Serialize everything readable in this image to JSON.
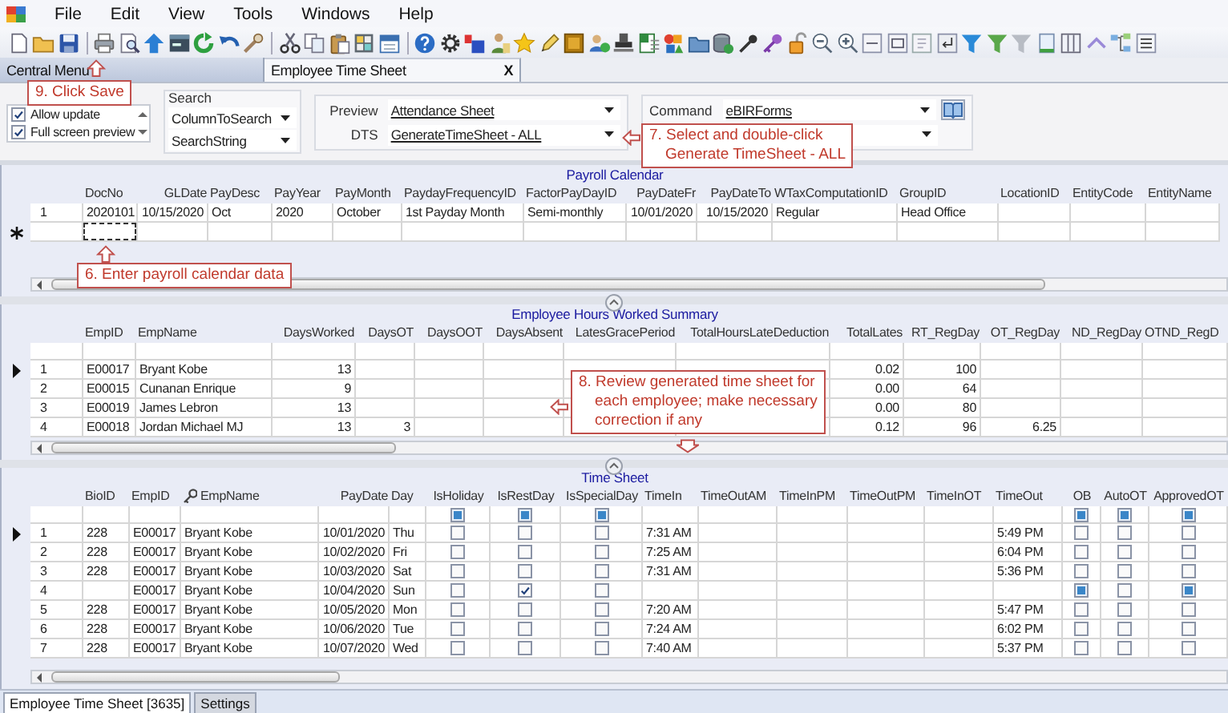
{
  "menu": [
    "File",
    "Edit",
    "View",
    "Tools",
    "Windows",
    "Help"
  ],
  "document_tabs": [
    {
      "label": "Central Menu",
      "selected": false
    },
    {
      "label": "Employee Time Sheet",
      "selected": true,
      "close": "X"
    }
  ],
  "options": [
    {
      "label": "Allow update",
      "checked": true
    },
    {
      "label": "Full screen preview",
      "checked": true
    }
  ],
  "search": {
    "title": "Search",
    "fields": [
      "ColumnToSearch",
      "SearchString"
    ]
  },
  "preview": {
    "label": "Preview",
    "value": "Attendance Sheet"
  },
  "dts": {
    "label": "DTS",
    "value": "GenerateTimeSheet - ALL"
  },
  "command": {
    "label": "Command",
    "value": "eBIRForms"
  },
  "payroll_calendar": {
    "title": "Payroll Calendar",
    "new_row": true,
    "columns": [
      {
        "label": "DocNo",
        "kind": "text"
      },
      {
        "label": "GLDate",
        "kind": "number"
      },
      {
        "label": "PayDesc",
        "kind": "text"
      },
      {
        "label": "PayYear",
        "kind": "text"
      },
      {
        "label": "PayMonth",
        "kind": "text"
      },
      {
        "label": "PaydayFrequencyID",
        "kind": "text"
      },
      {
        "label": "FactorPayDayID",
        "kind": "text"
      },
      {
        "label": "PayDateFr",
        "kind": "number"
      },
      {
        "label": "PayDateTo",
        "kind": "number"
      },
      {
        "label": "WTaxComputationID",
        "kind": "text"
      },
      {
        "label": "GroupID",
        "kind": "text"
      },
      {
        "label": "LocationID",
        "kind": "text"
      },
      {
        "label": "EntityCode",
        "kind": "text"
      },
      {
        "label": "EntityName",
        "kind": "text"
      }
    ],
    "rows": [
      {
        "number": "1",
        "cells": [
          "2020101",
          "10/15/2020",
          "Oct",
          "2020",
          "October",
          "1st Payday Month",
          "Semi-monthly",
          "10/01/2020",
          "10/15/2020",
          "Regular",
          "Head Office",
          null,
          null,
          null
        ]
      }
    ]
  },
  "hours_summary": {
    "title": "Employee Hours Worked Summary",
    "filter_row": true,
    "columns": [
      {
        "label": "EmpID",
        "kind": "text"
      },
      {
        "label": "EmpName",
        "kind": "text"
      },
      {
        "label": "DaysWorked",
        "kind": "number"
      },
      {
        "label": "DaysOT",
        "kind": "number"
      },
      {
        "label": "DaysOOT",
        "kind": "number"
      },
      {
        "label": "DaysAbsent",
        "kind": "number"
      },
      {
        "label": "LatesGracePeriod",
        "kind": "number"
      },
      {
        "label": "TotalHoursLateDeduction",
        "kind": "number"
      },
      {
        "label": "TotalLates",
        "kind": "number"
      },
      {
        "label": "RT_RegDay",
        "kind": "number"
      },
      {
        "label": "OT_RegDay",
        "kind": "number"
      },
      {
        "label": "ND_RegDay",
        "kind": "number"
      },
      {
        "label": "OTND_RegD",
        "kind": "text"
      }
    ],
    "rows": [
      {
        "number": "1",
        "current": true,
        "cells": [
          "E00017",
          "Bryant Kobe",
          "13",
          null,
          null,
          null,
          null,
          null,
          "0.02",
          "100",
          null,
          null,
          null
        ]
      },
      {
        "number": "2",
        "current": false,
        "cells": [
          "E00015",
          "Cunanan Enrique",
          "9",
          null,
          null,
          null,
          null,
          null,
          "0.00",
          "64",
          null,
          null,
          null
        ]
      },
      {
        "number": "3",
        "current": false,
        "cells": [
          "E00019",
          "James Lebron",
          "13",
          null,
          null,
          null,
          null,
          null,
          "0.00",
          "80",
          null,
          null,
          null
        ]
      },
      {
        "number": "4",
        "current": false,
        "cells": [
          "E00018",
          "Jordan Michael MJ",
          "13",
          "3",
          null,
          null,
          null,
          null,
          "0.12",
          "96",
          "6.25",
          null,
          null
        ]
      }
    ]
  },
  "time_sheet": {
    "title": "Time Sheet",
    "filter_row": true,
    "columns": [
      {
        "label": "BioID",
        "kind": "text"
      },
      {
        "label": "EmpID",
        "kind": "text"
      },
      {
        "label": "EmpName",
        "kind": "key"
      },
      {
        "label": "PayDate",
        "kind": "number"
      },
      {
        "label": "Day",
        "kind": "text"
      },
      {
        "label": "IsHoliday",
        "kind": "check",
        "filter_indeterminate": true
      },
      {
        "label": "IsRestDay",
        "kind": "check",
        "filter_indeterminate": true
      },
      {
        "label": "IsSpecialDay",
        "kind": "check",
        "filter_indeterminate": true
      },
      {
        "label": "TimeIn",
        "kind": "text"
      },
      {
        "label": "TimeOutAM",
        "kind": "text"
      },
      {
        "label": "TimeInPM",
        "kind": "text"
      },
      {
        "label": "TimeOutPM",
        "kind": "text"
      },
      {
        "label": "TimeInOT",
        "kind": "text"
      },
      {
        "label": "TimeOut",
        "kind": "text"
      },
      {
        "label": "OB",
        "kind": "check",
        "filter_indeterminate": true
      },
      {
        "label": "AutoOT",
        "kind": "check",
        "filter_indeterminate": true
      },
      {
        "label": "ApprovedOT",
        "kind": "check",
        "filter_indeterminate": true
      }
    ],
    "rows": [
      {
        "number": "1",
        "current": true,
        "cells": [
          "228",
          "E00017",
          "Bryant Kobe",
          "10/01/2020",
          "Thu",
          false,
          false,
          false,
          "7:31 AM",
          null,
          null,
          null,
          null,
          "5:49 PM",
          false,
          false,
          false
        ]
      },
      {
        "number": "2",
        "current": false,
        "cells": [
          "228",
          "E00017",
          "Bryant Kobe",
          "10/02/2020",
          "Fri",
          false,
          false,
          false,
          "7:25 AM",
          null,
          null,
          null,
          null,
          "6:04 PM",
          false,
          false,
          false
        ]
      },
      {
        "number": "3",
        "current": false,
        "cells": [
          "228",
          "E00017",
          "Bryant Kobe",
          "10/03/2020",
          "Sat",
          false,
          false,
          false,
          "7:31 AM",
          null,
          null,
          null,
          null,
          "5:36 PM",
          false,
          false,
          false
        ]
      },
      {
        "number": "4",
        "current": false,
        "cells": [
          null,
          "E00017",
          "Bryant Kobe",
          "10/04/2020",
          "Sun",
          false,
          true,
          false,
          null,
          null,
          null,
          null,
          null,
          null,
          null,
          false,
          null
        ]
      },
      {
        "number": "5",
        "current": false,
        "cells": [
          "228",
          "E00017",
          "Bryant Kobe",
          "10/05/2020",
          "Mon",
          false,
          false,
          false,
          "7:20 AM",
          null,
          null,
          null,
          null,
          "5:47 PM",
          false,
          false,
          false
        ]
      },
      {
        "number": "6",
        "current": false,
        "cells": [
          "228",
          "E00017",
          "Bryant Kobe",
          "10/06/2020",
          "Tue",
          false,
          false,
          false,
          "7:24 AM",
          null,
          null,
          null,
          null,
          "6:02 PM",
          false,
          false,
          false
        ]
      },
      {
        "number": "7",
        "current": false,
        "cells": [
          "228",
          "E00017",
          "Bryant Kobe",
          "10/07/2020",
          "Wed",
          false,
          false,
          false,
          "7:40 AM",
          null,
          null,
          null,
          null,
          "5:37 PM",
          false,
          false,
          false
        ]
      }
    ]
  },
  "bottom_tabs": [
    {
      "label": "Employee Time Sheet [3635]",
      "selected": true
    },
    {
      "label": "Settings",
      "selected": false
    }
  ],
  "callouts": [
    {
      "text": "9. Click Save",
      "arrows": [
        {
          "kind": "up"
        }
      ]
    },
    {
      "text": "7. Select and double-click\nGenerate TimeSheet - ALL",
      "arrows": [
        {
          "kind": "left"
        }
      ]
    },
    {
      "text": "6. Enter payroll calendar data",
      "arrows": [
        {
          "kind": "up"
        }
      ]
    },
    {
      "text": "8. Review generated time sheet for\neach employee; make necessary\ncorrection if any",
      "arrows": [
        {
          "kind": "left"
        },
        {
          "kind": "down"
        }
      ]
    }
  ]
}
